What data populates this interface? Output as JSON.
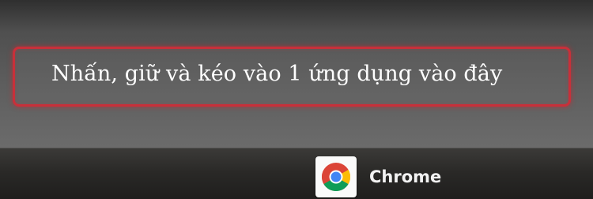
{
  "drop_zone": {
    "text": "Nhấn, giữ và kéo vào 1 ứng dụng vào đây",
    "border_color": "#c8303a"
  },
  "dock": {
    "apps": [
      {
        "label": "Chrome",
        "icon": "chrome-icon"
      }
    ]
  }
}
